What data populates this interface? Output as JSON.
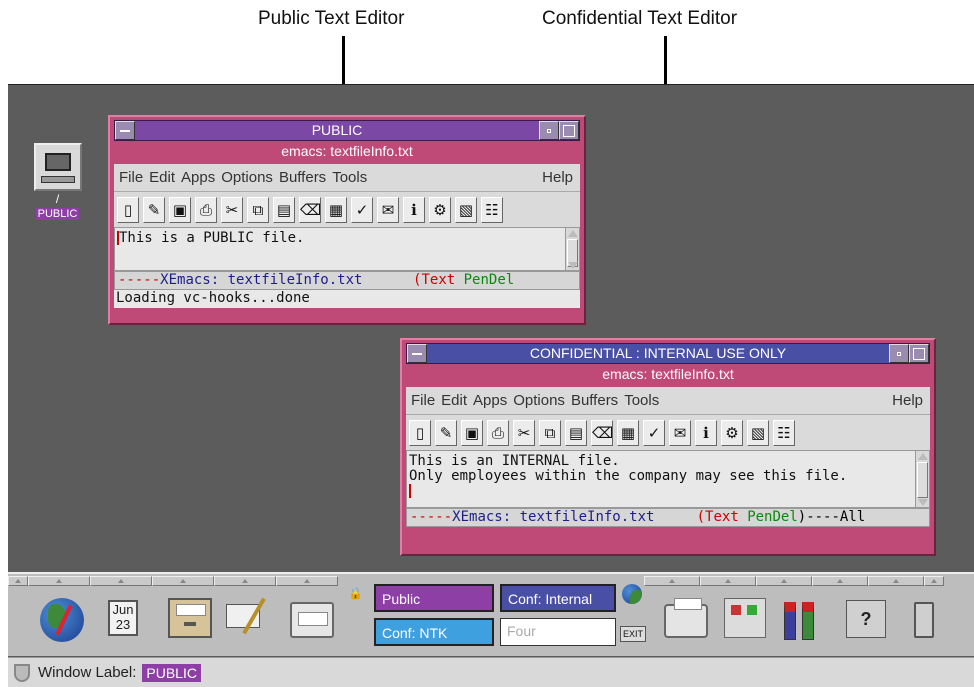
{
  "callouts": {
    "left": "Public Text Editor",
    "right": "Confidential Text Editor"
  },
  "desktop_icon": {
    "path": "/",
    "label": "PUBLIC"
  },
  "public_window": {
    "label_bar": "PUBLIC",
    "title": "emacs: textfileInfo.txt",
    "menu": [
      "File",
      "Edit",
      "Apps",
      "Options",
      "Buffers",
      "Tools"
    ],
    "help": "Help",
    "text_lines": [
      "This is a PUBLIC file."
    ],
    "modeline": {
      "dashes": "-----",
      "name": "XEmacs: textfileInfo.txt",
      "pad": "      ",
      "text_open": "(Text ",
      "pen": "PenDel",
      "tail": ""
    },
    "echo": "Loading vc-hooks...done",
    "accent": "#7b49a5"
  },
  "conf_window": {
    "label_bar": "CONFIDENTIAL : INTERNAL USE ONLY",
    "title": "emacs: textfileInfo.txt",
    "menu": [
      "File",
      "Edit",
      "Apps",
      "Options",
      "Buffers",
      "Tools"
    ],
    "help": "Help",
    "text_lines": [
      "This is an INTERNAL file.",
      "Only employees within the company may see this file."
    ],
    "modeline": {
      "dashes": "-----",
      "name": "XEmacs: textfileInfo.txt",
      "pad": "     ",
      "text_open": "(Text ",
      "pen": "PenDel",
      "tail": ")----All"
    },
    "accent": "#4a4fa6"
  },
  "toolbar_icons": [
    "new-file",
    "open-folder",
    "save",
    "print",
    "cut",
    "copy",
    "paste",
    "clear",
    "compile",
    "spell-check",
    "mail",
    "info",
    "debug",
    "news",
    "tree"
  ],
  "panel": {
    "calendar": {
      "month": "Jun",
      "day": "23"
    },
    "labels": {
      "public": "Public",
      "conf_internal": "Conf: Internal",
      "conf_ntk": "Conf: NTK",
      "four": "Four"
    },
    "exit": "EXIT"
  },
  "status": {
    "label": "Window Label:",
    "value": "PUBLIC"
  },
  "colors": {
    "public": "#8e3fa6",
    "internal": "#4a4fa6",
    "ntk": "#3fa0e0",
    "window_frame": "#bf4977",
    "desktop": "#5c5c5c"
  }
}
